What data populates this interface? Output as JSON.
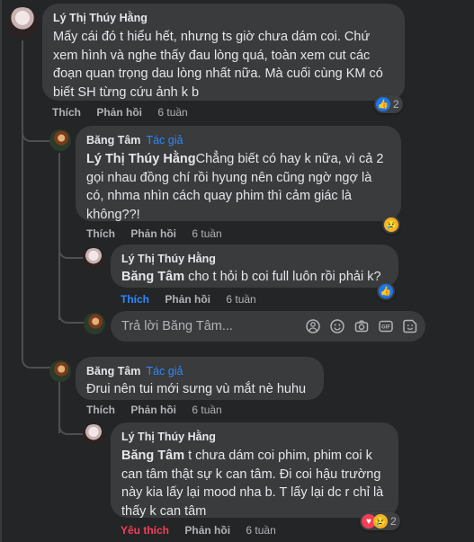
{
  "comment1": {
    "author": "Lý Thị Thúy Hằng",
    "text": "Mấy cái đó t hiểu hết, nhưng ts giờ chưa dám coi. Chứ xem hình và nghe thấy đau lòng quá, toàn xem cut các đoạn quan trọng dau lòng nhất nữa. Mà cuối cùng KM có biết SH từng cứu ảnh k b",
    "like_label": "Thích",
    "reply_label": "Phản hồi",
    "time": "6 tuần",
    "reaction_icon": "like-icon",
    "reaction_count": "2"
  },
  "reply1": {
    "author": "Băng Tâm",
    "badge": "Tác giả",
    "mention": "Lý Thị Thúy Hằng",
    "text": "Chẳng biết có hay k nữa, vì cả 2 gọi nhau đồng chí rồi hyung nên cũng ngờ ngợ là có, nhma nhìn cách quay phim thì cảm giác là không??!",
    "like_label": "Thích",
    "reply_label": "Phản hồi",
    "time": "6 tuần",
    "reaction_icon": "sad-icon"
  },
  "reply2": {
    "author": "Lý Thị Thúy Hằng",
    "mention": "Băng Tâm",
    "text": " cho t hỏi b coi full luôn rồi phải k?",
    "like_label": "Thích",
    "reply_label": "Phản hồi",
    "time": "6 tuần",
    "reaction_icon": "like-icon"
  },
  "reply_box": {
    "placeholder": "Trả lời Băng Tâm..."
  },
  "reply3": {
    "author": "Băng Tâm",
    "badge": "Tác giả",
    "text": "Đrui nên tui mới sưng vù mắt nè huhu",
    "like_label": "Thích",
    "reply_label": "Phản hồi",
    "time": "6 tuần"
  },
  "reply4": {
    "author": "Lý Thị Thúy Hằng",
    "mention": "Băng Tâm",
    "text": " t chưa dám coi phim, phim coi k can tâm thật sự k can tâm. Đi coi hậu trường này kia lấy lại mood nha b. T lấy lại dc r chỉ là thấy k can tâm",
    "like_label": "Yêu thích",
    "reply_label": "Phản hồi",
    "time": "6 tuần",
    "reaction_count": "2"
  },
  "colors": {
    "background": "#242526",
    "bubble": "#3a3b3c",
    "text": "#e4e6eb",
    "muted": "#b0b3b8",
    "accent": "#2d88ff",
    "love": "#f33e58"
  }
}
